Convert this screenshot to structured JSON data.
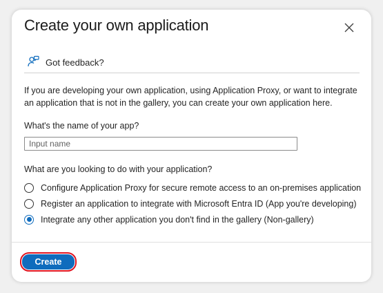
{
  "dialog": {
    "title": "Create your own application",
    "close_icon": "close-icon"
  },
  "feedback": {
    "label": "Got feedback?",
    "icon": "feedback-icon"
  },
  "description": "If you are developing your own application, using Application Proxy, or want to integrate an application that is not in the gallery, you can create your own application here.",
  "name_question": "What's the name of your app?",
  "name_input": {
    "placeholder": "Input name",
    "value": ""
  },
  "purpose_question": "What are you looking to do with your application?",
  "options": [
    {
      "label": "Configure Application Proxy for secure remote access to an on-premises application",
      "selected": false
    },
    {
      "label": "Register an application to integrate with Microsoft Entra ID (App you're developing)",
      "selected": false
    },
    {
      "label": "Integrate any other application you don't find in the gallery (Non-gallery)",
      "selected": true
    }
  ],
  "footer": {
    "create_label": "Create"
  },
  "colors": {
    "accent": "#0f6cbd",
    "highlight_border": "#e0131f"
  }
}
